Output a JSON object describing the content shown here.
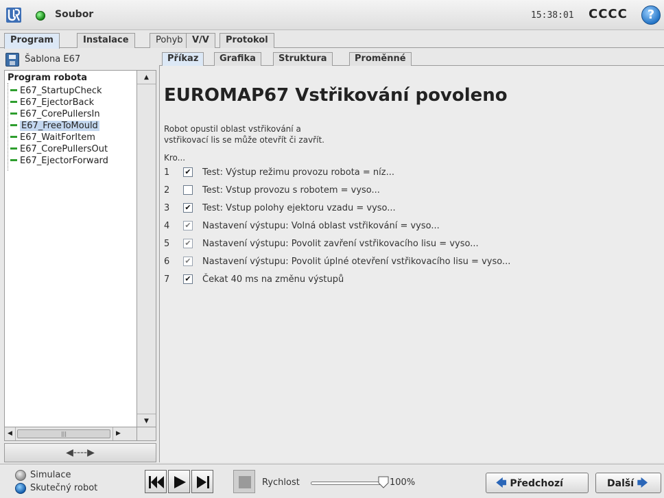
{
  "header": {
    "file_menu": "Soubor",
    "clock": "15:38:01",
    "robot_name": "CCCC",
    "help_glyph": "?"
  },
  "main_tabs": [
    "Program",
    "Instalace",
    "Pohyb",
    "V/V",
    "Protokol"
  ],
  "left": {
    "template_label": "Šablona E67",
    "tree_root": "Program robota",
    "tree_items": [
      "E67_StartupCheck",
      "E67_EjectorBack",
      "E67_CorePullersIn",
      "E67_FreeToMould",
      "E67_WaitForItem",
      "E67_CorePullersOut",
      "E67_EjectorForward"
    ],
    "selected_item": "E67_FreeToMould",
    "drag_handle": "◀----▶"
  },
  "sub_tabs": [
    "Příkaz",
    "Grafika",
    "Struktura",
    "Proměnné"
  ],
  "command": {
    "title": "EUROMAP67 Vstřikování povoleno",
    "description_line1": "Robot opustil oblast vstřikování a",
    "description_line2": "vstřikovací lis se může otevřít či zavřít.",
    "steps_label": "Kro...",
    "steps": [
      {
        "num": "1",
        "checked": true,
        "enabled": true,
        "text": "Test: Výstup režimu provozu robota = níz..."
      },
      {
        "num": "2",
        "checked": false,
        "enabled": true,
        "text": "Test: Vstup provozu s robotem = vyso..."
      },
      {
        "num": "3",
        "checked": true,
        "enabled": true,
        "text": "Test: Vstup polohy ejektoru vzadu = vyso..."
      },
      {
        "num": "4",
        "checked": true,
        "enabled": false,
        "text": "Nastavení výstupu: Volná oblast vstřikování = vyso..."
      },
      {
        "num": "5",
        "checked": true,
        "enabled": false,
        "text": "Nastavení výstupu: Povolit zavření vstřikovacího lisu = vyso..."
      },
      {
        "num": "6",
        "checked": true,
        "enabled": false,
        "text": "Nastavení výstupu: Povolit úplné otevření vstřikovacího lisu = vyso..."
      },
      {
        "num": "7",
        "checked": true,
        "enabled": true,
        "text": "Čekat 40 ms na změnu výstupů"
      }
    ]
  },
  "bottom": {
    "mode_simulation": "Simulace",
    "mode_real": "Skutečný robot",
    "speed_label": "Rychlost",
    "speed_value": "100%",
    "speed_fraction": 1.0,
    "prev_label": "Předchozí",
    "next_label": "Další"
  },
  "colors": {
    "active_tab": "#dce8f6",
    "selection": "#c4d8f0",
    "accent_blue": "#2a66b8",
    "tree_dash": "#2e9e2e"
  }
}
